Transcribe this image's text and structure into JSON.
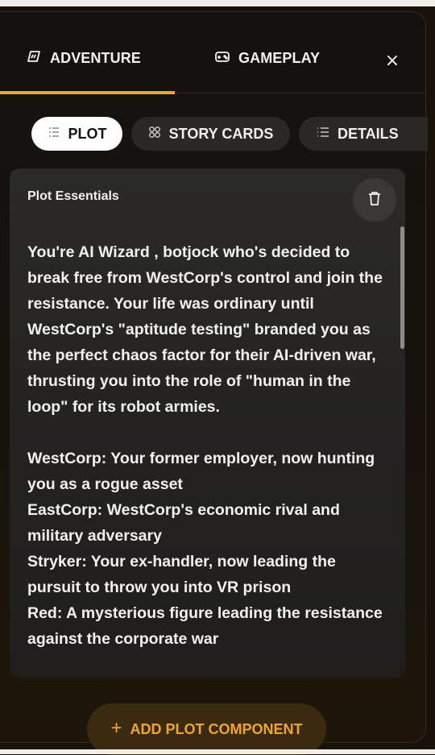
{
  "header": {
    "tabs": [
      {
        "label": "ADVENTURE",
        "icon": "adventure-icon",
        "active": true
      },
      {
        "label": "GAMEPLAY",
        "icon": "gamepad-icon",
        "active": false
      }
    ],
    "close_symbol": "×"
  },
  "subtabs": [
    {
      "label": "PLOT",
      "icon": "plot-list-icon",
      "active": true
    },
    {
      "label": "STORY CARDS",
      "icon": "cards-grid-icon",
      "active": false
    },
    {
      "label": "DETAILS",
      "icon": "list-icon",
      "active": false
    }
  ],
  "card": {
    "title": "Plot Essentials",
    "paragraph1": "You're AI Wizard , botjock who's decided to break free from WestCorp's control and join the resistance. Your life was ordinary until WestCorp's \"aptitude testing\" branded you as the perfect chaos factor for their AI-driven war, thrusting you into the role of \"human in the loop\" for its robot armies.",
    "lines": [
      "WestCorp: Your former employer, now hunting you as a rogue asset",
      "EastCorp: WestCorp's economic rival and military adversary",
      "Stryker: Your ex-handler, now leading the pursuit to throw you into VR prison",
      "Red: A mysterious figure leading the resistance against the corporate war"
    ]
  },
  "add_button": {
    "plus": "+",
    "label": "ADD PLOT COMPONENT"
  },
  "colors": {
    "accent": "#f0a52a",
    "background": "#1a1209",
    "card": "#262523",
    "pill_inactive": "#2a2825"
  }
}
